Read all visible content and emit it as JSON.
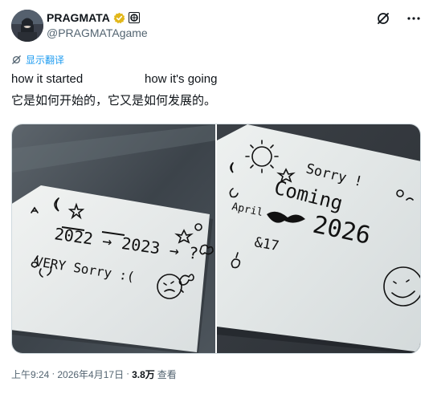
{
  "author": {
    "name": "PRAGMATA",
    "handle": "@PRAGMATAgame"
  },
  "translate_label": "显示翻译",
  "tweet": {
    "line1_left": "how it started",
    "line1_right": "how it's going",
    "line2": "它是如何开始的，它又是如何发展的。"
  },
  "images": {
    "left_note": {
      "line1": "2022 → 2023 → ?",
      "line2": "VERY Sorry :("
    },
    "right_note": {
      "line1": "Sorry !",
      "line2": "Coming",
      "line3": "April",
      "line4": "2026",
      "line5": "&17"
    }
  },
  "meta": {
    "time": "上午9:24",
    "date": "2026年4月17日",
    "separator": "·",
    "views_count": "3.8万",
    "views_label": "查看"
  },
  "colors": {
    "accent": "#1d9bf0",
    "gold_badge": "#e2b719",
    "muted": "#536471"
  },
  "icons": [
    "verified-icon",
    "affiliate-badge-icon",
    "grok-icon",
    "more-icon",
    "translate-icon"
  ]
}
